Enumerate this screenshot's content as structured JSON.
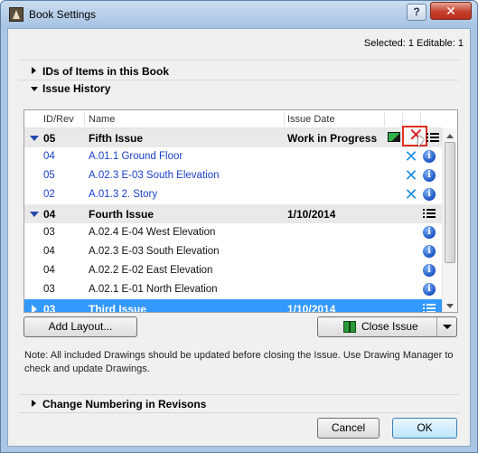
{
  "window": {
    "title": "Book Settings",
    "help_label": "?",
    "close_label": "✕"
  },
  "selected_info": "Selected: 1 Editable: 1",
  "sections": {
    "ids": "IDs of Items in this Book",
    "history": "Issue History",
    "numbering": "Change Numbering in Revisons"
  },
  "table": {
    "headers": {
      "id": "ID/Rev",
      "name": "Name",
      "date": "Issue Date"
    },
    "rows": [
      {
        "id": "05",
        "name": "Fifth Issue",
        "date": "Work in Progress"
      },
      {
        "id": "04",
        "name": "A.01.1 Ground Floor",
        "date": ""
      },
      {
        "id": "05",
        "name": "A.02.3 E-03 South Elevation",
        "date": ""
      },
      {
        "id": "02",
        "name": "A.01.3 2. Story",
        "date": ""
      },
      {
        "id": "04",
        "name": "Fourth Issue",
        "date": "1/10/2014"
      },
      {
        "id": "03",
        "name": "A.02.4 E-04 West Elevation",
        "date": ""
      },
      {
        "id": "04",
        "name": "A.02.3 E-03 South Elevation",
        "date": ""
      },
      {
        "id": "04",
        "name": "A.02.2 E-02 East Elevation",
        "date": ""
      },
      {
        "id": "03",
        "name": "A.02.1 E-01 North Elevation",
        "date": ""
      },
      {
        "id": "03",
        "name": "Third Issue",
        "date": "1/10/2014"
      }
    ]
  },
  "buttons": {
    "add_layout": "Add Layout...",
    "close_issue": "Close Issue",
    "cancel": "Cancel",
    "ok": "OK"
  },
  "note": "Note: All included Drawings should be updated before closing the Issue. Use Drawing Manager to check and update Drawings.",
  "icons": {
    "info": "i",
    "delete": "✕"
  },
  "colors": {
    "selection": "#3399ff",
    "link_text": "#1a3fc7",
    "delete_highlight": "#e03020"
  }
}
